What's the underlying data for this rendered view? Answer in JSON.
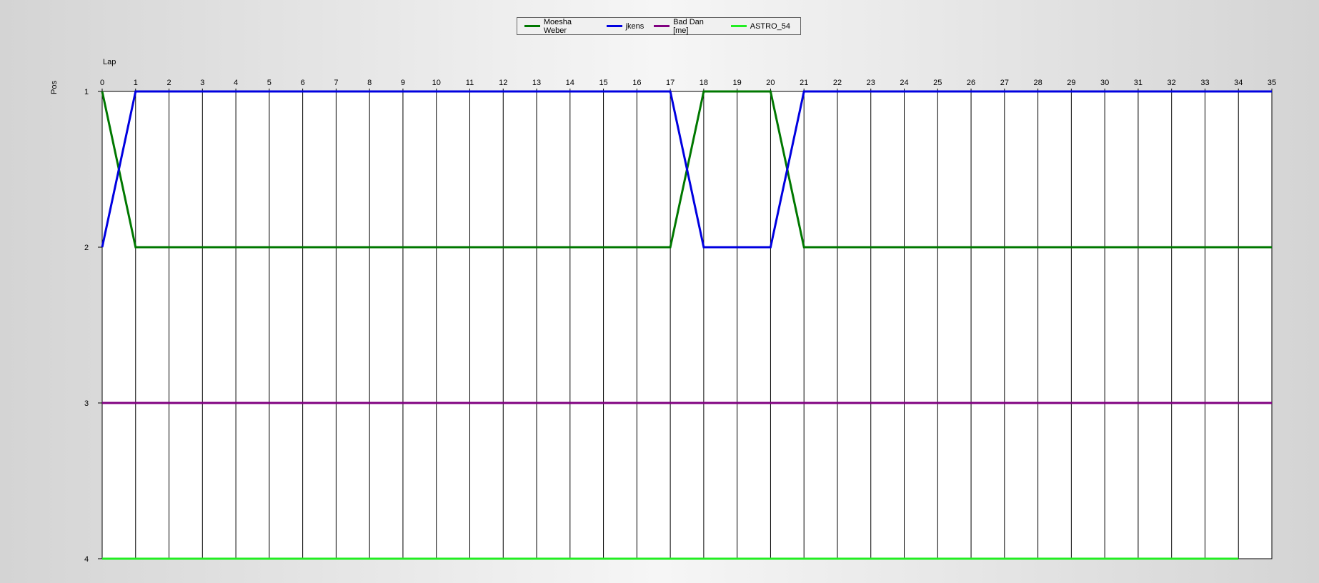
{
  "chart_data": {
    "type": "line",
    "xlabel": "Lap",
    "ylabel": "Pos",
    "x": [
      0,
      1,
      2,
      3,
      4,
      5,
      6,
      7,
      8,
      9,
      10,
      11,
      12,
      13,
      14,
      15,
      16,
      17,
      18,
      19,
      20,
      21,
      22,
      23,
      24,
      25,
      26,
      27,
      28,
      29,
      30,
      31,
      32,
      33,
      34,
      35
    ],
    "xlim": [
      0,
      35
    ],
    "ylim": [
      1,
      4
    ],
    "y_inverted": true,
    "y_ticks": [
      1,
      2,
      3,
      4
    ],
    "grid": "vertical",
    "legend_position": "top-center",
    "series": [
      {
        "name": "Moesha Weber",
        "color": "#007800",
        "values": [
          1,
          2,
          2,
          2,
          2,
          2,
          2,
          2,
          2,
          2,
          2,
          2,
          2,
          2,
          2,
          2,
          2,
          2,
          1,
          1,
          1,
          2,
          2,
          2,
          2,
          2,
          2,
          2,
          2,
          2,
          2,
          2,
          2,
          2,
          2,
          2
        ]
      },
      {
        "name": "jkens",
        "color": "#0000e0",
        "values": [
          2,
          1,
          1,
          1,
          1,
          1,
          1,
          1,
          1,
          1,
          1,
          1,
          1,
          1,
          1,
          1,
          1,
          1,
          2,
          2,
          2,
          1,
          1,
          1,
          1,
          1,
          1,
          1,
          1,
          1,
          1,
          1,
          1,
          1,
          1,
          1
        ]
      },
      {
        "name": "Bad Dan [me]",
        "color": "#800080",
        "values": [
          3,
          3,
          3,
          3,
          3,
          3,
          3,
          3,
          3,
          3,
          3,
          3,
          3,
          3,
          3,
          3,
          3,
          3,
          3,
          3,
          3,
          3,
          3,
          3,
          3,
          3,
          3,
          3,
          3,
          3,
          3,
          3,
          3,
          3,
          3,
          3
        ]
      },
      {
        "name": "ASTRO_54",
        "color": "#22ee22",
        "values": [
          4,
          4,
          4,
          4,
          4,
          4,
          4,
          4,
          4,
          4,
          4,
          4,
          4,
          4,
          4,
          4,
          4,
          4,
          4,
          4,
          4,
          4,
          4,
          4,
          4,
          4,
          4,
          4,
          4,
          4,
          4,
          4,
          4,
          4,
          4
        ]
      }
    ]
  }
}
